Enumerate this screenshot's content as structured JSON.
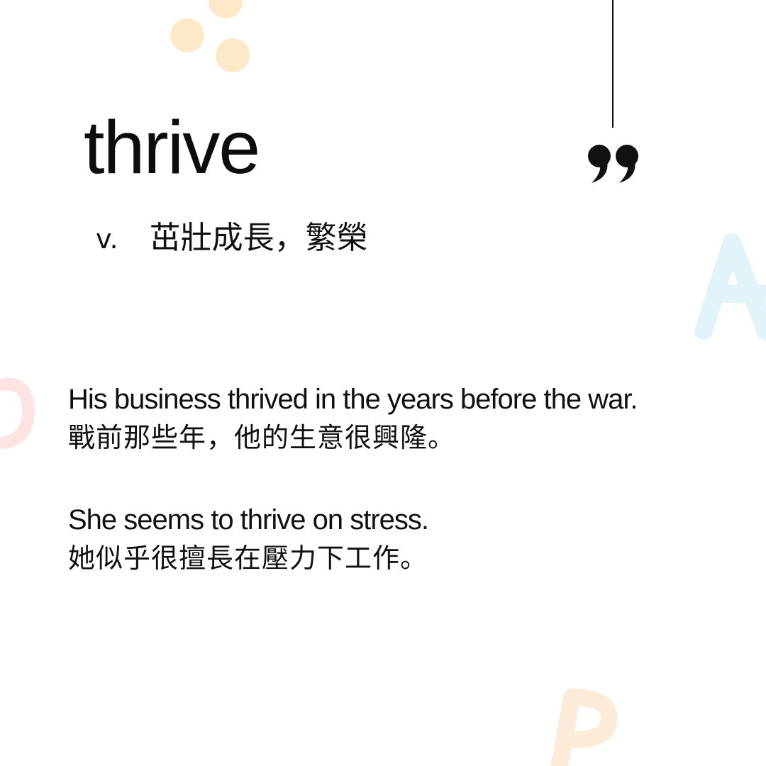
{
  "word": {
    "headword": "thrive",
    "part_of_speech": "v.",
    "definition": "茁壯成長，繁榮"
  },
  "examples": [
    {
      "en": "His business thrived in the years before the war.",
      "zh": "戰前那些年，他的生意很興隆。"
    },
    {
      "en": "She seems to thrive on stress.",
      "zh": "她似乎很擅長在壓力下工作。"
    }
  ],
  "decorations": {
    "letters": [
      "A",
      "C",
      "B"
    ],
    "colors": {
      "dots": "#fde9c8",
      "letter_a": "#e3f3fa",
      "letter_c": "#fde3e3",
      "letter_b": "#fdebd9",
      "ink": "#111111"
    },
    "icons": [
      "quote-mark-icon"
    ]
  }
}
